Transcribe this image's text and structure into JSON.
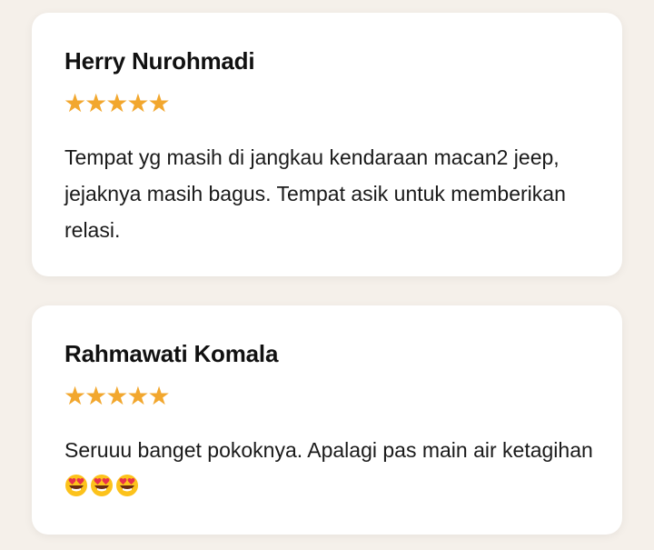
{
  "reviews": [
    {
      "name": "Herry Nurohmadi",
      "rating": 5,
      "text": "Tempat yg masih di jangkau kendaraan macan2 jeep, jejaknya masih bagus. Tempat asik untuk memberikan relasi.",
      "emojis": []
    },
    {
      "name": "Rahmawati Komala",
      "rating": 5,
      "text": "Seruuu banget pokoknya. Apalagi pas main air ketagihan ",
      "emojis": [
        "smiling-face-with-heart-eyes",
        "smiling-face-with-heart-eyes",
        "smiling-face-with-heart-eyes"
      ]
    }
  ],
  "colors": {
    "page_bg": "#f5f0ea",
    "card_bg": "#ffffff",
    "star": "#f2a72e",
    "text": "#1a1a1a"
  }
}
